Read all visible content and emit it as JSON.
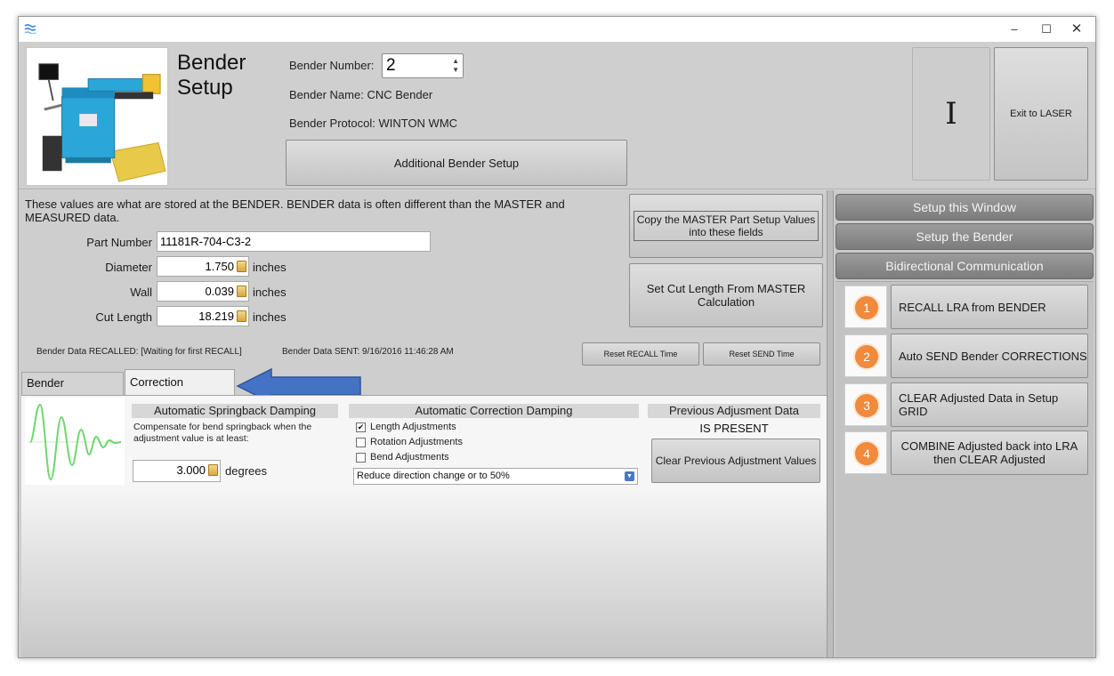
{
  "window": {
    "minimize_glyph": "–",
    "maximize_glyph": "☐",
    "close_glyph": "✕"
  },
  "header": {
    "title_line1": "Bender",
    "title_line2": "Setup",
    "bender_number_label": "Bender Number:",
    "bender_number_value": "2",
    "bender_name_label": "Bender Name:",
    "bender_name_value": "CNC Bender",
    "bender_protocol_label": "Bender Protocol:",
    "bender_protocol_value": "WINTON WMC",
    "additional_setup_label": "Additional Bender Setup",
    "cursor_glyph": "I",
    "exit_label": "Exit to LASER"
  },
  "main": {
    "info_text": "These values are what are stored at the BENDER.  BENDER data is often different than the MASTER and MEASURED data.",
    "copy_master_label": "Copy the MASTER Part Setup Values into these fields",
    "cut_length_master_label": "Set Cut Length From MASTER Calculation",
    "fields": {
      "part_number_label": "Part Number",
      "part_number_value": "11181R-704-C3-2",
      "diameter_label": "Diameter",
      "diameter_value": "1.750",
      "wall_label": "Wall",
      "wall_value": "0.039",
      "cut_length_label": "Cut Length",
      "cut_length_value": "18.219",
      "unit": "inches"
    },
    "recalled_status": "Bender Data RECALLED:  [Waiting for first RECALL]",
    "sent_status": "Bender Data SENT:  9/16/2016 11:46:28 AM",
    "reset_recall_label": "Reset RECALL Time",
    "reset_send_label": "Reset SEND Time"
  },
  "tabs": [
    {
      "label": "Bender Adjustment"
    },
    {
      "label": "Correction Damping"
    }
  ],
  "damping": {
    "springback_header": "Automatic Springback Damping",
    "springback_desc": "Compensate for bend springback when the adjustment value is at least:",
    "springback_value": "3.000",
    "springback_unit": "degrees",
    "correction_header": "Automatic Correction Damping",
    "checkboxes": [
      {
        "label": "Length Adjustments",
        "checked": true
      },
      {
        "label": "Rotation Adjustments",
        "checked": false
      },
      {
        "label": "Bend Adjustments",
        "checked": false
      }
    ],
    "dropdown_value": "Reduce direction change or to 50%",
    "previous_header": "Previous Adjusment Data",
    "previous_status": "IS PRESENT",
    "clear_previous_label": "Clear Previous Adjustment Values"
  },
  "sidebar": {
    "headers": [
      {
        "label": "Setup this Window"
      },
      {
        "label": "Setup the Bender"
      },
      {
        "label": "Bidirectional Communication"
      }
    ],
    "steps": [
      {
        "number": "1",
        "label": "RECALL LRA from BENDER"
      },
      {
        "number": "2",
        "label": "Auto SEND Bender CORRECTIONS"
      },
      {
        "number": "3",
        "label": "CLEAR Adjusted Data in Setup GRID"
      },
      {
        "number": "4",
        "label": "COMBINE Adjusted back into LRA then CLEAR Adjusted"
      }
    ]
  },
  "colors": {
    "accent_arrow": "#4472c4",
    "step_circle": "#f08a3c",
    "wave_line": "#6fd66f"
  }
}
